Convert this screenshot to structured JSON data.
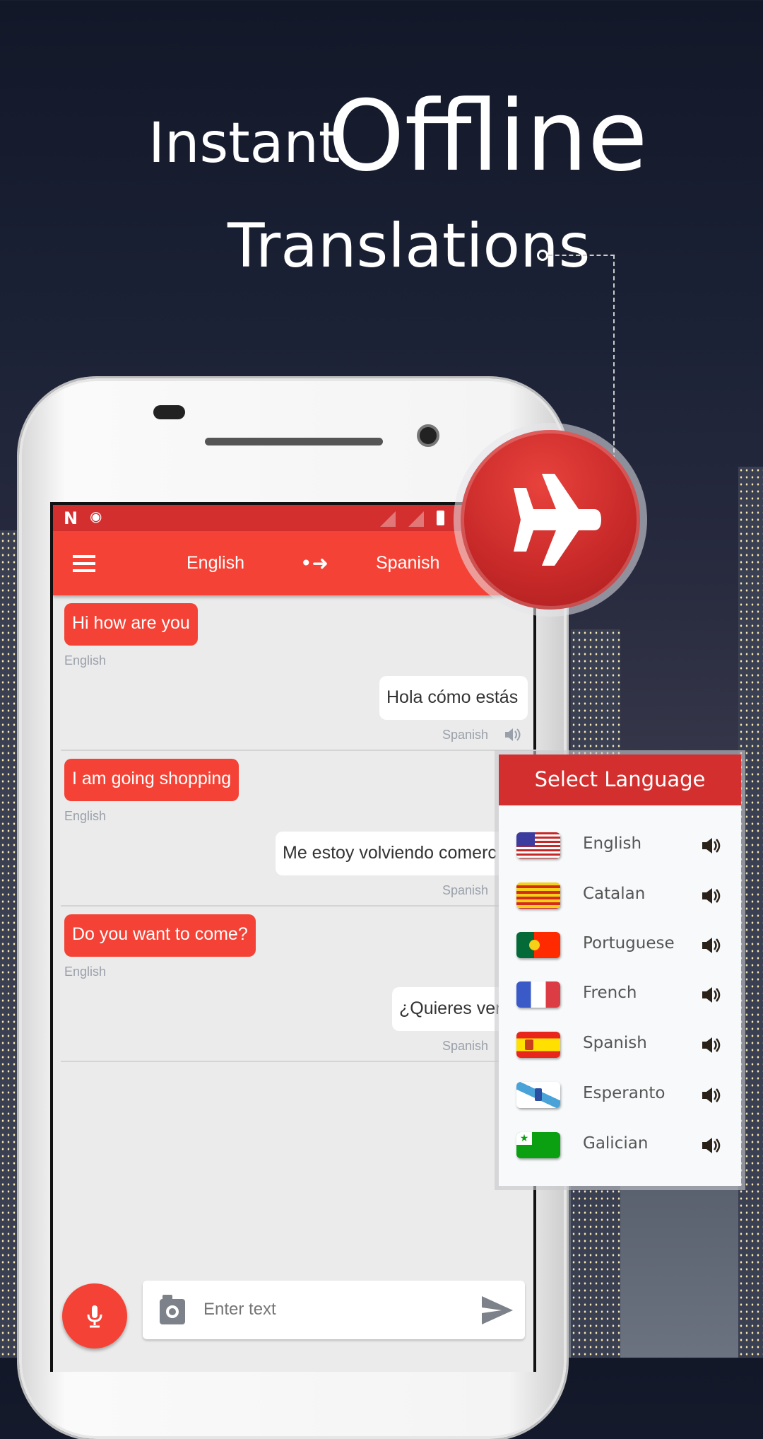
{
  "headline": {
    "line1_small": "Instant",
    "line1_big": "Offline",
    "line2": "Translations"
  },
  "toolbar": {
    "source_lang": "English",
    "target_lang": "Spanish",
    "menu_icon": "hamburger-icon",
    "swap_icon": "arrow-right-icon"
  },
  "status_bar": {
    "icons": [
      "n-icon",
      "incognito-icon",
      "signal-icon",
      "signal-icon",
      "battery-charging-icon"
    ]
  },
  "badge": {
    "icon": "airplane-icon",
    "color": "#d32f2f"
  },
  "messages": [
    {
      "source": "Hi how are you",
      "source_lang": "English",
      "translation": "Hola cómo estás",
      "target_lang": "Spanish"
    },
    {
      "source": "I am going shopping",
      "source_lang": "English",
      "translation": "Me estoy volviendo comerc",
      "target_lang": "Spanish"
    },
    {
      "source": "Do you want to come?",
      "source_lang": "English",
      "translation": "¿Quieres ven",
      "target_lang": "Spanish"
    }
  ],
  "input": {
    "placeholder": "Enter text",
    "camera_icon": "camera-icon",
    "send_icon": "send-icon",
    "mic_icon": "microphone-icon"
  },
  "language_panel": {
    "title": "Select Language",
    "languages": [
      {
        "name": "English",
        "flag": "us-flag"
      },
      {
        "name": "Catalan",
        "flag": "catalan-flag"
      },
      {
        "name": "Portuguese",
        "flag": "portugal-flag"
      },
      {
        "name": "French",
        "flag": "france-flag"
      },
      {
        "name": "Spanish",
        "flag": "spain-flag"
      },
      {
        "name": "Esperanto",
        "flag": "galicia-flag"
      },
      {
        "name": "Galician",
        "flag": "esperanto-flag"
      }
    ]
  },
  "colors": {
    "primary": "#f44336",
    "primary_dark": "#d32f2f"
  }
}
